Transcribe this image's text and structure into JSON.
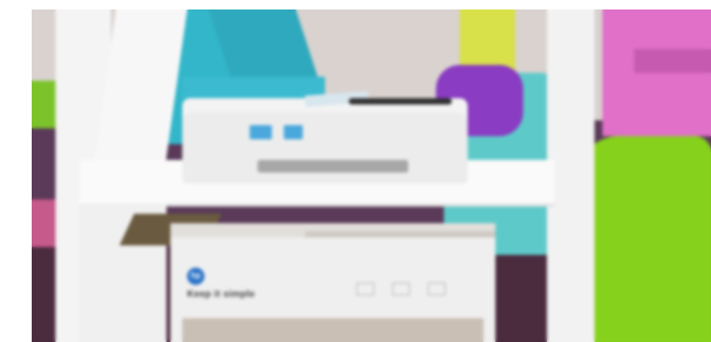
{
  "photo": {
    "box_logo_text": "hp",
    "box_headline": "Keep it simple",
    "box_subtext": "",
    "colors": {
      "printer_accent": "#4aa8dd",
      "letter_a_teal": "#33b6c9",
      "green_cushion": "#86d11c",
      "pink_shelf": "#e070c8",
      "purple_cushion": "#8a3cc2",
      "hp_logo_blue": "#2b73c7"
    }
  }
}
